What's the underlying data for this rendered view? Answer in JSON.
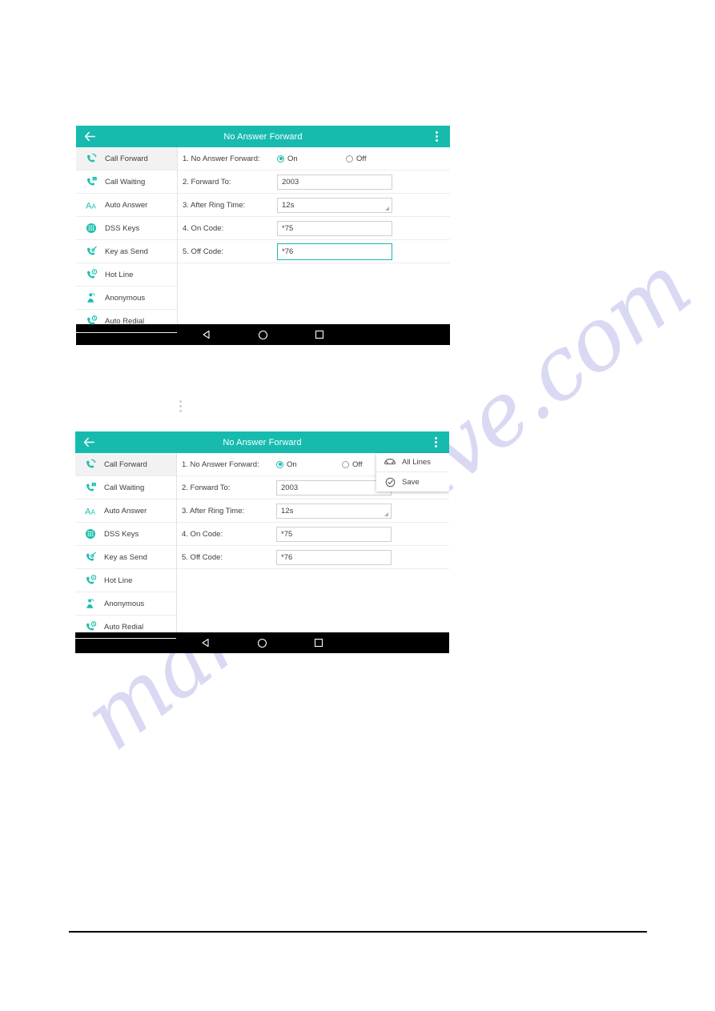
{
  "page": {
    "watermark_text": "manualshive.com",
    "watermark_color": "#d9d9f3",
    "accent_color": "#17bbae",
    "navbar_color": "#000000"
  },
  "sidebar": {
    "items": [
      {
        "label": "Call Forward",
        "icon": "call-forward-icon",
        "active": true
      },
      {
        "label": "Call Waiting",
        "icon": "call-waiting-icon",
        "active": false
      },
      {
        "label": "Auto Answer",
        "icon": "auto-answer-icon",
        "active": false
      },
      {
        "label": "DSS Keys",
        "icon": "dss-keys-icon",
        "active": false
      },
      {
        "label": "Key as Send",
        "icon": "key-as-send-icon",
        "active": false
      },
      {
        "label": "Hot Line",
        "icon": "hot-line-icon",
        "active": false
      },
      {
        "label": "Anonymous",
        "icon": "anonymous-icon",
        "active": false
      },
      {
        "label": "Auto Redial",
        "icon": "auto-redial-icon",
        "active": false
      }
    ]
  },
  "screen_one": {
    "titlebar": {
      "title": "No Answer Forward",
      "back_icon": "back-arrow-icon",
      "menu_icon": "overflow-menu-icon"
    },
    "form": {
      "rows": [
        {
          "label": "1. No Answer Forward:",
          "type": "radio"
        },
        {
          "label": "2. Forward To:",
          "type": "text",
          "value": "2003",
          "focused": false
        },
        {
          "label": "3. After Ring Time:",
          "type": "select",
          "value": "12s",
          "focused": false
        },
        {
          "label": "4. On Code:",
          "type": "text",
          "value": "*75",
          "focused": false
        },
        {
          "label": "5. Off Code:",
          "type": "text",
          "value": "*76",
          "focused": true
        }
      ],
      "radio_on_label": "On",
      "radio_off_label": "Off",
      "radio_selected": "On"
    },
    "navbar": {
      "back": "back-triangle-icon",
      "home": "home-circle-icon",
      "recents": "recents-square-icon"
    }
  },
  "screen_two": {
    "titlebar": {
      "title": "No Answer Forward",
      "back_icon": "back-arrow-icon",
      "menu_icon": "overflow-menu-icon"
    },
    "form": {
      "rows": [
        {
          "label": "1. No Answer Forward:",
          "type": "radio"
        },
        {
          "label": "2. Forward To:",
          "type": "text",
          "value": "2003",
          "focused": false
        },
        {
          "label": "3. After Ring Time:",
          "type": "select",
          "value": "12s",
          "focused": false
        },
        {
          "label": "4. On Code:",
          "type": "text",
          "value": "*75",
          "focused": false
        },
        {
          "label": "5. Off Code:",
          "type": "text",
          "value": "*76",
          "focused": false
        }
      ],
      "radio_on_label": "On",
      "radio_off_label": "Off",
      "radio_selected": "On"
    },
    "popup_menu": {
      "items": [
        {
          "label": "All Lines",
          "icon": "telephone-icon"
        },
        {
          "label": "Save",
          "icon": "check-circle-icon"
        }
      ]
    },
    "navbar": {
      "back": "back-triangle-icon",
      "home": "home-circle-icon",
      "recents": "recents-square-icon"
    }
  },
  "instruction_glyph": {
    "icon": "overflow-menu-icon"
  }
}
